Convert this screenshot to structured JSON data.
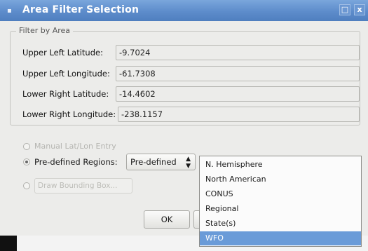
{
  "window": {
    "title": "Area Filter Selection",
    "title_icon": "▪",
    "maximize_glyph": "□",
    "close_glyph": "x"
  },
  "filter_group": {
    "title": "Filter by Area",
    "fields": [
      {
        "label": "Upper Left Latitude:",
        "value": "-9.7024"
      },
      {
        "label": "Upper Left Longitude:",
        "value": "-61.7308"
      },
      {
        "label": "Lower Right Latitude:",
        "value": "-14.4602"
      },
      {
        "label": "Lower Right Longitude:",
        "value": "-238.1157"
      }
    ]
  },
  "options": {
    "manual_label": "Manual Lat/Lon Entry",
    "predefined_label": "Pre-defined Regions:",
    "predefined_selected": "Pre-defined",
    "draw_box_label": "Draw Bounding Box..."
  },
  "dropdown": {
    "items": [
      "N. Hemisphere",
      "North American",
      "CONUS",
      "Regional",
      "State(s)",
      "WFO"
    ],
    "selected_index": 5
  },
  "buttons": {
    "ok": "OK"
  },
  "colors": {
    "title_bar": "#5d8ccb",
    "selection": "#6a9bd8",
    "window_bg": "#ececea"
  }
}
